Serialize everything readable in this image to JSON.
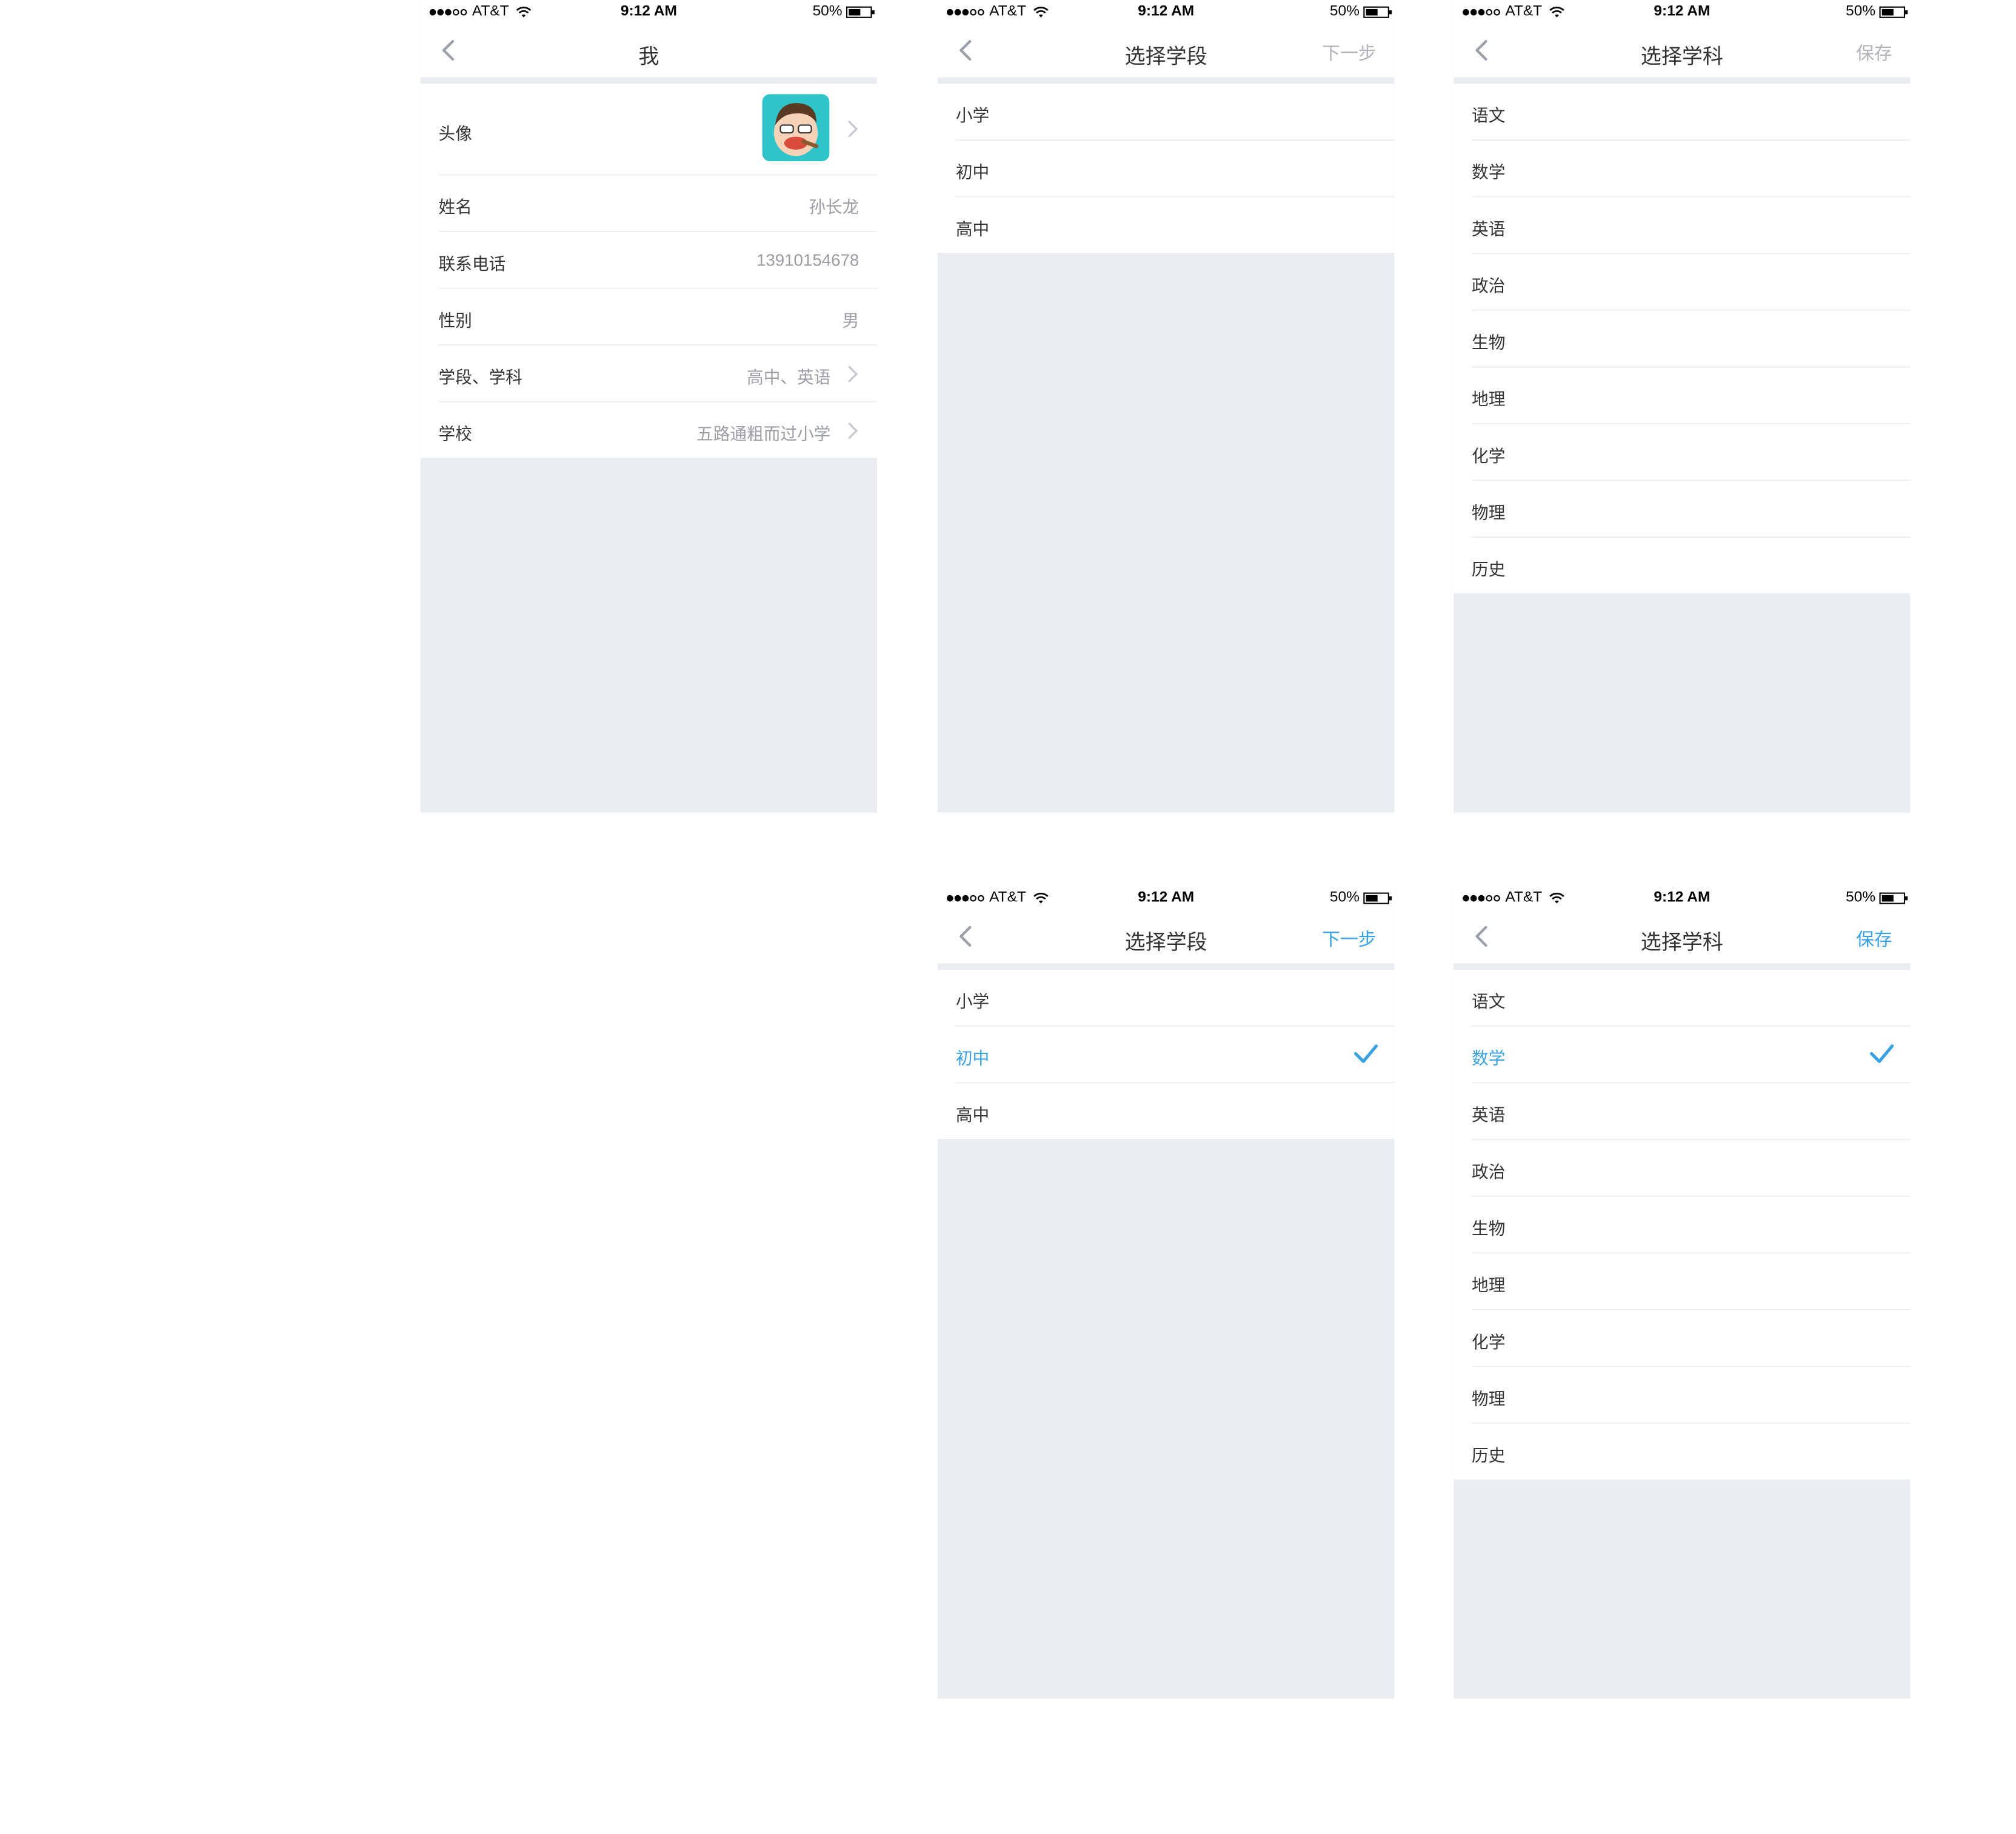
{
  "status_bar": {
    "carrier": "AT&T",
    "time": "9:12 AM",
    "battery": "50%"
  },
  "screens": {
    "profile": {
      "title": "我",
      "rows": [
        {
          "label": "头像"
        },
        {
          "label": "姓名",
          "value": "孙长龙"
        },
        {
          "label": "联系电话",
          "value": "13910154678"
        },
        {
          "label": "性别",
          "value": "男"
        },
        {
          "label": "学段、学科",
          "value": "高中、英语"
        },
        {
          "label": "学校",
          "value": "五路通粗而过小学"
        }
      ]
    },
    "stage_inactive": {
      "title": "选择学段",
      "action": "下一步",
      "items": [
        "小学",
        "初中",
        "高中"
      ]
    },
    "subject_inactive": {
      "title": "选择学科",
      "action": "保存",
      "items": [
        "语文",
        "数学",
        "英语",
        "政治",
        "生物",
        "地理",
        "化学",
        "物理",
        "历史"
      ]
    },
    "stage_active": {
      "title": "选择学段",
      "action": "下一步",
      "items": [
        "小学",
        "初中",
        "高中"
      ],
      "selected": "初中"
    },
    "subject_active": {
      "title": "选择学科",
      "action": "保存",
      "items": [
        "语文",
        "数学",
        "英语",
        "政治",
        "生物",
        "地理",
        "化学",
        "物理",
        "历史"
      ],
      "selected": "数学"
    }
  },
  "colors": {
    "accent": "#3aa0e4",
    "background": "#e9edf0",
    "avatar_bg": "#2fc4c9",
    "disabled_action": "#b0b3b8"
  }
}
